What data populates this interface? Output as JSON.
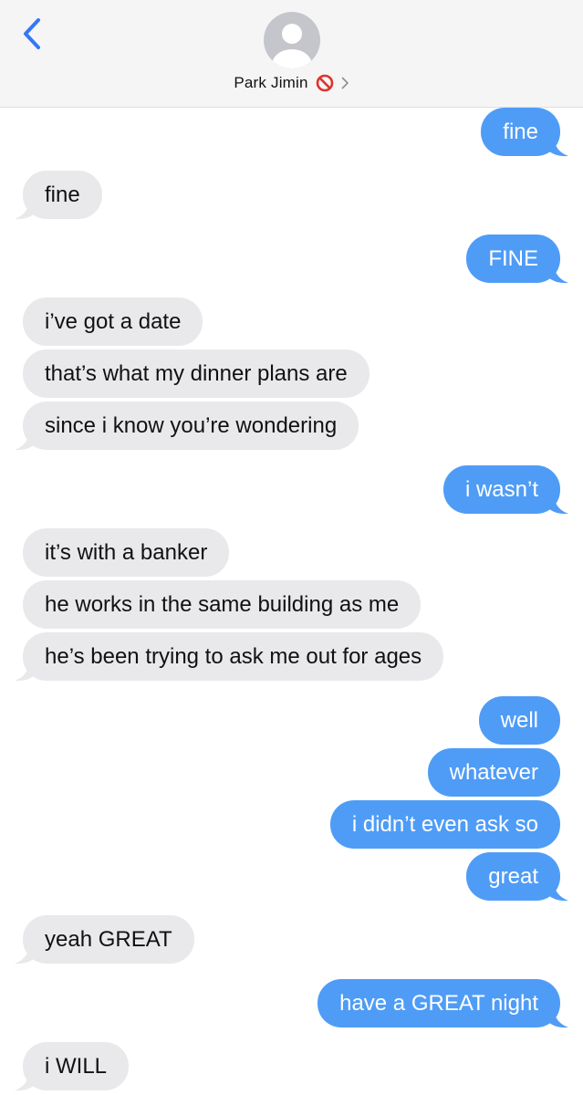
{
  "header": {
    "contact_name": "Park Jimin",
    "status_emoji": "🚫",
    "back_icon": "chevron-left-icon",
    "avatar_icon": "person-icon",
    "disclosure_icon": "chevron-right-icon"
  },
  "colors": {
    "incoming_bubble": "#e9e9eb",
    "outgoing_bubble": "#4f9cf7",
    "accent": "#3478f6"
  },
  "messages": [
    {
      "from": "me",
      "text": "fine"
    },
    {
      "from": "them",
      "text": "fine"
    },
    {
      "from": "me",
      "text": "FINE"
    },
    {
      "from": "them",
      "text": "i’ve got a date"
    },
    {
      "from": "them",
      "text": "that’s what my dinner plans are"
    },
    {
      "from": "them",
      "text": "since i know you’re wondering"
    },
    {
      "from": "me",
      "text": "i wasn’t"
    },
    {
      "from": "them",
      "text": "it’s with a banker"
    },
    {
      "from": "them",
      "text": "he works in the same building as me"
    },
    {
      "from": "them",
      "text": "he’s been trying to ask me out for ages"
    },
    {
      "from": "me",
      "text": "well"
    },
    {
      "from": "me",
      "text": "whatever"
    },
    {
      "from": "me",
      "text": "i didn’t even ask so"
    },
    {
      "from": "me",
      "text": "great"
    },
    {
      "from": "them",
      "text": "yeah GREAT"
    },
    {
      "from": "me",
      "text": "have a GREAT night"
    },
    {
      "from": "them",
      "text": "i WILL"
    }
  ]
}
